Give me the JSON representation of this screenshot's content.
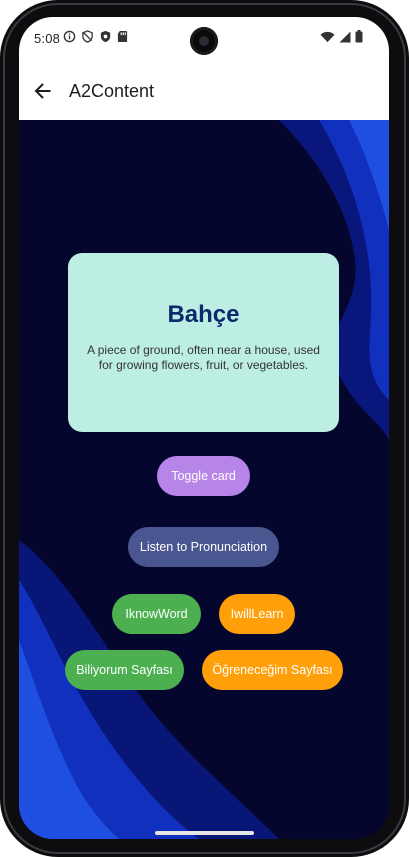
{
  "status_bar": {
    "time": "5:08"
  },
  "app_bar": {
    "title": "A2Content"
  },
  "card": {
    "word": "Bahçe",
    "definition": "A piece of ground, often near a house, used for growing flowers, fruit, or vegetables."
  },
  "buttons": {
    "toggle_card": "Toggle card",
    "listen": "Listen to Pronunciation",
    "know_word": "IknowWord",
    "will_learn": "IwillLearn",
    "known_page": "Biliyorum Sayfası",
    "learn_page": "Öğreneceğim Sayfası"
  },
  "colors": {
    "card_bg": "#bdeee4",
    "card_word": "#0b2a6e",
    "toggle_btn": "#b784e8",
    "listen_btn": "#4a5690",
    "green_btn": "#4caf50",
    "orange_btn": "#ff9f0a",
    "content_bg": "#04062e"
  }
}
